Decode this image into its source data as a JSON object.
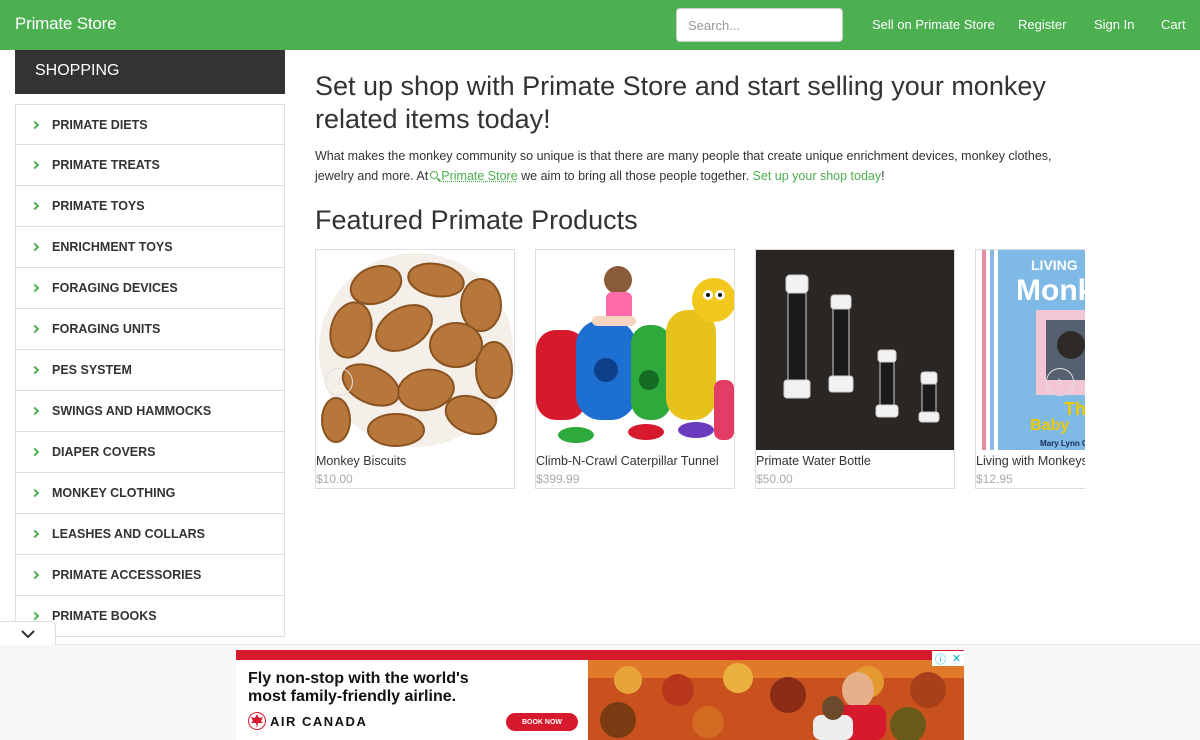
{
  "topbar": {
    "brand": "Primate Store",
    "search_placeholder": "Search...",
    "links": [
      "Sell on Primate Store",
      "Register",
      "Sign In",
      "Cart"
    ]
  },
  "sidebar": {
    "title": "SHOPPING",
    "items": [
      "PRIMATE DIETS",
      "PRIMATE TREATS",
      "PRIMATE TOYS",
      "ENRICHMENT TOYS",
      "FORAGING DEVICES",
      "FORAGING UNITS",
      "PES SYSTEM",
      "SWINGS AND HAMMOCKS",
      "DIAPER COVERS",
      "MONKEY CLOTHING",
      "LEASHES AND COLLARS",
      "PRIMATE ACCESSORIES",
      "PRIMATE BOOKS"
    ]
  },
  "main": {
    "heading": "Set up shop with Primate Store and start selling your monkey related items today!",
    "intro_part1": "What makes the monkey community so unique is that there are many people that create unique enrichment devices, monkey clothes, jewelry and more. At",
    "intro_store_link": "Primate Store",
    "intro_part2": " we aim to bring all those people together. ",
    "intro_cta": "Set up your shop today",
    "intro_end": "!",
    "featured_title": "Featured Primate Products",
    "products": [
      {
        "name": "Monkey Biscuits",
        "price": "$10.00",
        "icon": "biscuits-image"
      },
      {
        "name": "Climb-N-Crawl Caterpillar Tunnel",
        "price": "$399.99",
        "icon": "caterpillar-tunnel-image"
      },
      {
        "name": "Primate Water Bottle",
        "price": "$50.00",
        "icon": "water-bottle-image"
      },
      {
        "name": "Living with Monkeys",
        "price": "$12.95",
        "icon": "book-cover-image"
      }
    ],
    "book_cover_text": {
      "line1": "LIVING",
      "line2": "Monk",
      "line3": "Th",
      "line4": "Baby",
      "author": "Mary Lynn C"
    }
  },
  "ad": {
    "headline": "Fly non-stop with the world's most family-friendly airline.",
    "brand": "AIR CANADA",
    "cta": "BOOK NOW",
    "accent_color": "#d7192d"
  },
  "colors": {
    "brand_green": "#4caf50",
    "sidebar_header": "#333333"
  }
}
